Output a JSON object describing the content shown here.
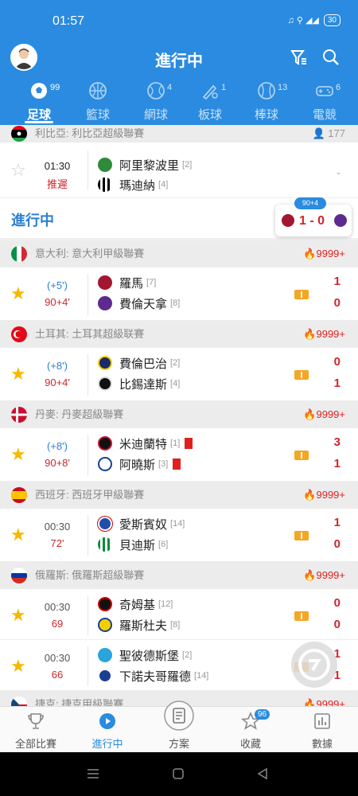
{
  "status": {
    "time": "01:57",
    "icons": "♫ ⚲ ◢◢ ",
    "battery": "30"
  },
  "header": {
    "title": "進行中"
  },
  "tabs": [
    {
      "label": "足球",
      "count": "99"
    },
    {
      "label": "籃球",
      "count": ""
    },
    {
      "label": "網球",
      "count": "4"
    },
    {
      "label": "板球",
      "count": "1"
    },
    {
      "label": "棒球",
      "count": "13"
    },
    {
      "label": "電競",
      "count": "6"
    }
  ],
  "top_league": {
    "name": "利比亞: 利比亞超級聯賽",
    "count": "177"
  },
  "top_match": {
    "time": "01:30",
    "status": "推遲",
    "home": "阿里黎波里",
    "home_rank": "[2]",
    "away": "瑪迪納",
    "away_rank": "[4]",
    "score": "-"
  },
  "section": {
    "title": "進行中",
    "mini_tag": "90+4",
    "mini_score": "1 - 0"
  },
  "groups": [
    {
      "league": "意大利: 意大利甲級聯賽",
      "hot": "9999+",
      "time": "(+5')",
      "minute": "90+4'",
      "home": "羅馬",
      "home_rank": "[7]",
      "away": "費倫天拿",
      "away_rank": "[8]",
      "hs": "1",
      "as": "0"
    },
    {
      "league": "土耳其: 土耳其超級联賽",
      "hot": "9999+",
      "time": "(+8')",
      "minute": "90+4'",
      "home": "費倫巴治",
      "home_rank": "[2]",
      "away": "比錫達斯",
      "away_rank": "[4]",
      "hs": "0",
      "as": "1"
    },
    {
      "league": "丹麥: 丹麥超級聯賽",
      "hot": "9999+",
      "time": "(+8')",
      "minute": "90+8'",
      "home": "米迪蘭特",
      "home_rank": "[1]",
      "away": "阿曉斯",
      "away_rank": "[3]",
      "hs": "3",
      "as": "1"
    },
    {
      "league": "西班牙: 西班牙甲級聯賽",
      "hot": "9999+",
      "time": "00:30",
      "minute": "72'",
      "home": "愛斯賓奴",
      "home_rank": "[14]",
      "away": "貝迪斯",
      "away_rank": "[6]",
      "hs": "1",
      "as": "0"
    },
    {
      "league": "俄羅斯: 俄羅斯超級聯賽",
      "hot": "9999+",
      "time": "00:30",
      "minute": "69",
      "home": "奇姆基",
      "home_rank": "[12]",
      "away": "羅斯杜夫",
      "away_rank": "[8]",
      "hs": "0",
      "as": "0"
    }
  ],
  "extra_match": {
    "time": "00:30",
    "minute": "66",
    "home": "聖彼德斯堡",
    "home_rank": "[2]",
    "away": "下諾夫哥羅德",
    "away_rank": "[14]",
    "hs": "1",
    "as": "1"
  },
  "cut_league": {
    "name": "捷克: 捷克甲級聯賽",
    "hot": "9999+"
  },
  "bottom_nav": [
    {
      "label": "全部比賽"
    },
    {
      "label": "進行中"
    },
    {
      "label": "方案"
    },
    {
      "label": "收藏",
      "badge": "96"
    },
    {
      "label": "數據"
    }
  ]
}
